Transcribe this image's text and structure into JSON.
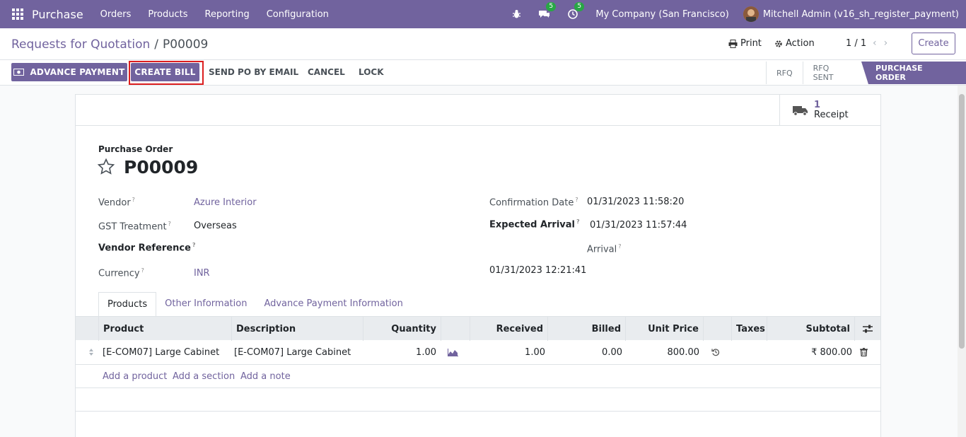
{
  "navbar": {
    "app_name": "Purchase",
    "menu": [
      "Orders",
      "Products",
      "Reporting",
      "Configuration"
    ],
    "messages_count": "5",
    "activities_count": "5",
    "company": "My Company (San Francisco)",
    "user": "Mitchell Admin (v16_sh_register_payment)"
  },
  "control_panel": {
    "breadcrumb_parent": "Requests for Quotation",
    "breadcrumb_sep": "/",
    "breadcrumb_current": "P00009",
    "print_label": "Print",
    "action_label": "Action",
    "pager": "1 / 1",
    "create_label": "Create"
  },
  "actions": {
    "advance_payment": "ADVANCE PAYMENT",
    "create_bill": "CREATE BILL",
    "send_po": "SEND PO BY EMAIL",
    "cancel": "CANCEL",
    "lock": "LOCK"
  },
  "status": {
    "stages": [
      "RFQ",
      "RFQ SENT",
      "PURCHASE ORDER"
    ],
    "current": "PURCHASE ORDER"
  },
  "smart_button": {
    "count": "1",
    "label": "Receipt"
  },
  "form": {
    "title_label": "Purchase Order",
    "name": "P00009",
    "vendor_label": "Vendor",
    "vendor": "Azure Interior",
    "gst_label": "GST Treatment",
    "gst": "Overseas",
    "vendor_ref_label": "Vendor Reference",
    "currency_label": "Currency",
    "currency": "INR",
    "confirmation_label": "Confirmation Date",
    "confirmation": "01/31/2023 11:58:20",
    "expected_label": "Expected Arrival",
    "expected": "01/31/2023 11:57:44",
    "arrival_label": "Arrival",
    "arrival": "01/31/2023 12:21:41",
    "help_mark": "?"
  },
  "tabs": [
    "Products",
    "Other Information",
    "Advance Payment Information"
  ],
  "table": {
    "headers": [
      "Product",
      "Description",
      "Quantity",
      "Received",
      "Billed",
      "Unit Price",
      "Taxes",
      "Subtotal"
    ],
    "rows": [
      {
        "product": "[E-COM07] Large Cabinet",
        "description": "[E-COM07] Large Cabinet",
        "quantity": "1.00",
        "received": "1.00",
        "billed": "0.00",
        "unit_price": "800.00",
        "taxes": "",
        "subtotal": "₹ 800.00"
      }
    ],
    "add_product": "Add a product",
    "add_section": "Add a section",
    "add_note": "Add a note"
  },
  "colors": {
    "brand": "#71639e",
    "highlight": "#dc1e1e"
  }
}
